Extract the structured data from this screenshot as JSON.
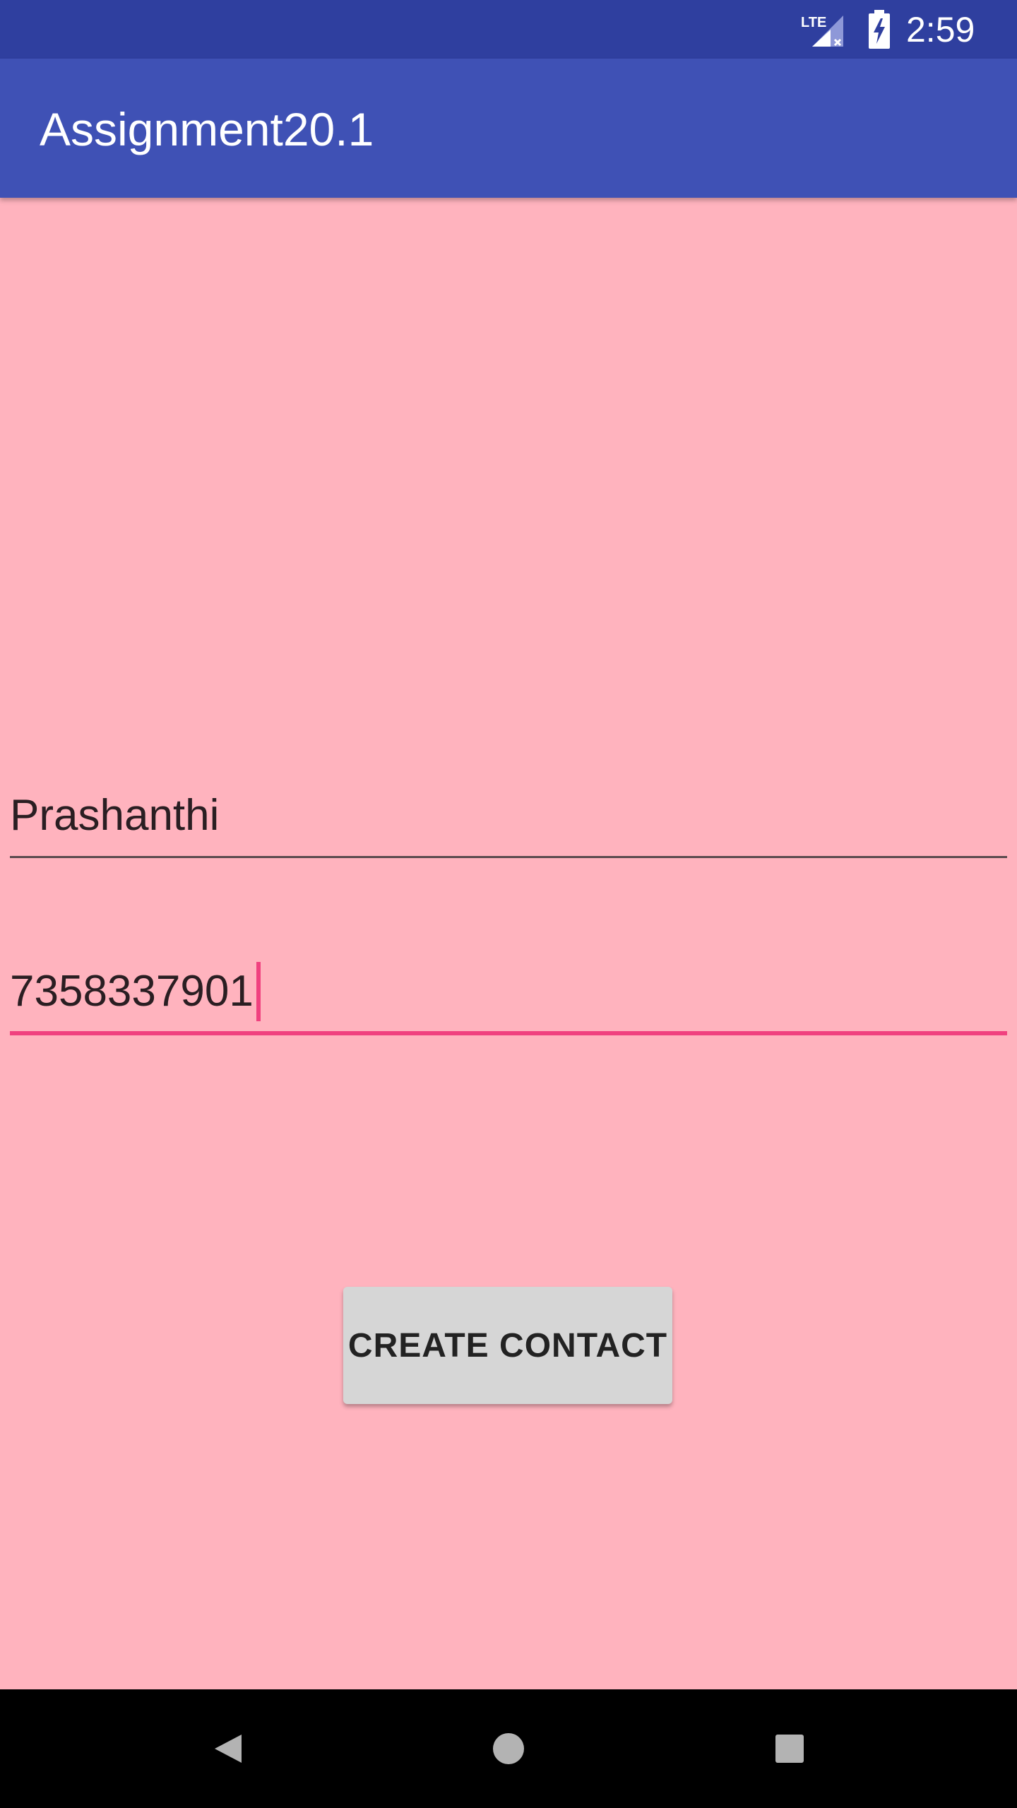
{
  "status_bar": {
    "network_label": "LTE",
    "time": "2:59",
    "icons": [
      "lte-signal-icon",
      "battery-charging-icon"
    ],
    "background_color": "#2F3F9F"
  },
  "app_bar": {
    "title": "Assignment20.1",
    "background_color": "#3F51B5"
  },
  "form": {
    "name_field": {
      "value": "Prashanthi"
    },
    "phone_field": {
      "value": "7358337901",
      "focused": true,
      "accent_color": "#F0417F"
    },
    "create_button_label": "CREATE CONTACT"
  },
  "screen": {
    "background_color": "#FFB3BE"
  },
  "nav_bar": {
    "buttons": [
      "back-icon",
      "home-icon",
      "recents-icon"
    ]
  }
}
